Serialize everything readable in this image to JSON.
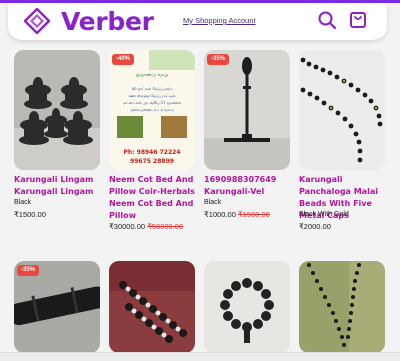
{
  "brand": {
    "name": "Verber",
    "accent": "#8a23c9"
  },
  "header": {
    "account_link": "My Shopping Account",
    "search_icon": "search-icon",
    "cart_icon": "shopping-bag-icon"
  },
  "products": [
    {
      "badge": "",
      "name": "Karungali Lingam Karungali Lingam",
      "variant": "Black",
      "price": "₹1500.00",
      "old_price": ""
    },
    {
      "badge": "-40%",
      "name": "Neem Cot Bed And Pillow Coir-Herbals Neem Cot Bed And Pillow",
      "variant": "",
      "price": "₹30000.00",
      "old_price": "₹50000.00"
    },
    {
      "badge": "-35%",
      "name": "1690988307649 Karungali-Vel",
      "variant": "Black",
      "price": "₹1000.00",
      "old_price": "₹1500.00"
    },
    {
      "badge": "",
      "name": "Karungali Panchaloga Malai Beads With Five Metal Caps",
      "variant": "Black With Gold",
      "price": "₹2000.00",
      "old_price": ""
    },
    {
      "badge": "-35%",
      "name": "",
      "variant": "",
      "price": "",
      "old_price": ""
    },
    {
      "badge": "",
      "name": "",
      "variant": "",
      "price": "",
      "old_price": ""
    },
    {
      "badge": "",
      "name": "",
      "variant": "",
      "price": "",
      "old_price": ""
    },
    {
      "badge": "",
      "name": "",
      "variant": "",
      "price": "",
      "old_price": ""
    }
  ],
  "poster": {
    "heading": "நூறாண்டு வாழ",
    "lines": [
      "40 நாட்கள் வேப்பமரம்",
      "ஊற வைத்த வேப்பு கட்டில்",
      "மட்டைகள் அடங்கிய 27 மூலிகை",
      "தலையணை, உடல் நலம்"
    ],
    "phone1": "Ph: 98946 72224",
    "phone2": "99675 28899"
  }
}
